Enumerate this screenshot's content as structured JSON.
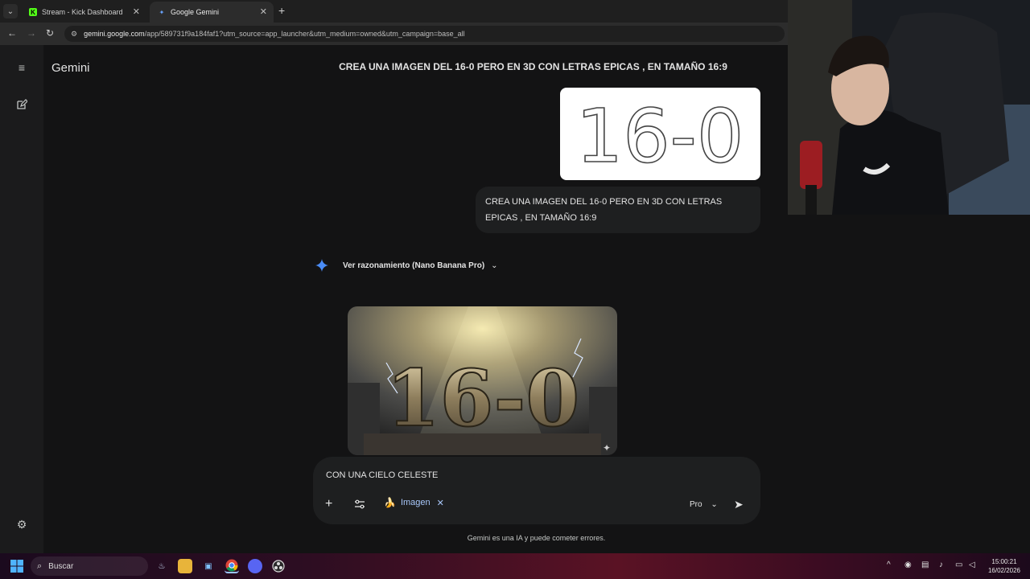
{
  "browser": {
    "tabs": [
      {
        "label": "Stream - Kick Dashboard",
        "active": false,
        "favicon": "kick-icon"
      },
      {
        "label": "Google Gemini",
        "active": true,
        "favicon": "gemini-icon"
      }
    ],
    "url_host": "gemini.google.com",
    "url_path": "/app/589731f9a184faf1?utm_source=app_launcher&utm_medium=owned&utm_campaign=base_all"
  },
  "app": {
    "brand": "Gemini",
    "conversation_title": "CREA UNA IMAGEN DEL 16-0 PERO EN 3D CON LETRAS EPICAS , EN TAMAÑO 16:9",
    "upload_handwriting": "16-0",
    "user_message_line1": "CREA UNA IMAGEN DEL 16-0 PERO EN 3D CON LETRAS",
    "user_message_line2": "EPICAS , EN TAMAÑO 16:9",
    "reasoning_label": "Ver razonamiento (Nano Banana Pro)",
    "generated_image_text": "16-0",
    "composer": {
      "input_value": "CON UNA CIELO CELESTE",
      "chip_label": "Imagen",
      "mode_label": "Pro"
    },
    "disclaimer": "Gemini es una IA y puede cometer errores."
  },
  "taskbar": {
    "search_placeholder": "Buscar",
    "time": "15:00:21",
    "date": "16/02/2026"
  },
  "colors": {
    "background": "#131314",
    "accent": "#a8c7fa",
    "gemini_star": "#4a8cf7"
  }
}
